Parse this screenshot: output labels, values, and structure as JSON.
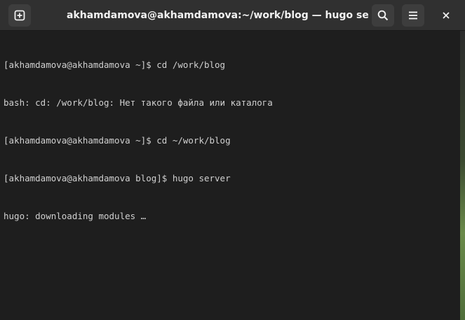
{
  "window": {
    "title": "akhamdamova@akhamdamova:~/work/blog — hugo server"
  },
  "titlebar": {
    "buttons": [
      {
        "name": "new-tab",
        "icon": "plus-in-box-icon"
      },
      {
        "name": "search",
        "icon": "search-icon"
      },
      {
        "name": "menu",
        "icon": "hamburger-menu-icon"
      },
      {
        "name": "close",
        "icon": "close-icon"
      }
    ]
  },
  "terminal": {
    "lines": [
      "[akhamdamova@akhamdamova ~]$ cd /work/blog",
      "bash: cd: /work/blog: Нет такого файла или каталога",
      "[akhamdamova@akhamdamova ~]$ cd ~/work/blog",
      "[akhamdamova@akhamdamova blog]$ hugo server",
      "hugo: downloading modules …"
    ]
  },
  "colors": {
    "titlebar_bg": "#303030",
    "terminal_bg": "#1e1e1e",
    "text": "#d0d0d0"
  }
}
